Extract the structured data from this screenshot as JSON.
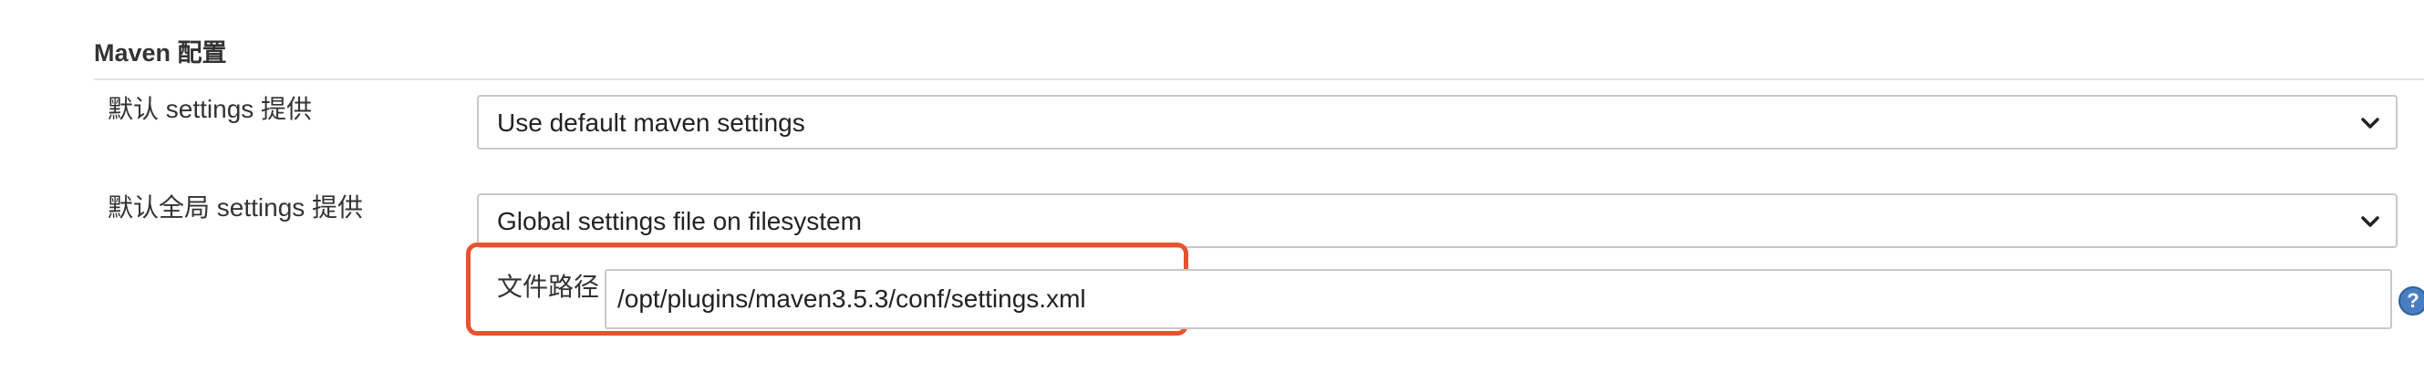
{
  "section": {
    "title": "Maven 配置"
  },
  "rows": [
    {
      "label": "默认 settings 提供",
      "select_value": "Use default maven settings"
    },
    {
      "label": "默认全局 settings 提供",
      "select_value": "Global settings file on filesystem"
    }
  ],
  "file_path": {
    "label": "文件路径",
    "value": "/opt/plugins/maven3.5.3/conf/settings.xml"
  },
  "icons": {
    "select_arrow": "chevron-down-icon",
    "help": "help-icon",
    "help_glyph": "?"
  },
  "colors": {
    "highlight_border": "#e8522d",
    "help_icon": "#4a7ec2"
  }
}
